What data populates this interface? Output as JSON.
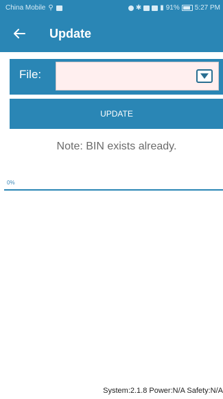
{
  "status_bar": {
    "carrier": "China Mobile",
    "battery": "91%",
    "time": "5:27 PM"
  },
  "app_bar": {
    "title": "Update",
    "back_icon": "arrow-left-icon"
  },
  "file_select": {
    "label": "File:",
    "value": "",
    "dropdown_icon": "chevron-down-icon"
  },
  "update_button": {
    "label": "UPDATE"
  },
  "note": "Note: BIN exists already.",
  "progress": {
    "label": "0%",
    "value": 0
  },
  "footer": "System:2.1.8 Power:N/A Safety:N/A",
  "colors": {
    "primary": "#2a86b5",
    "select_bg": "#ffefef"
  }
}
